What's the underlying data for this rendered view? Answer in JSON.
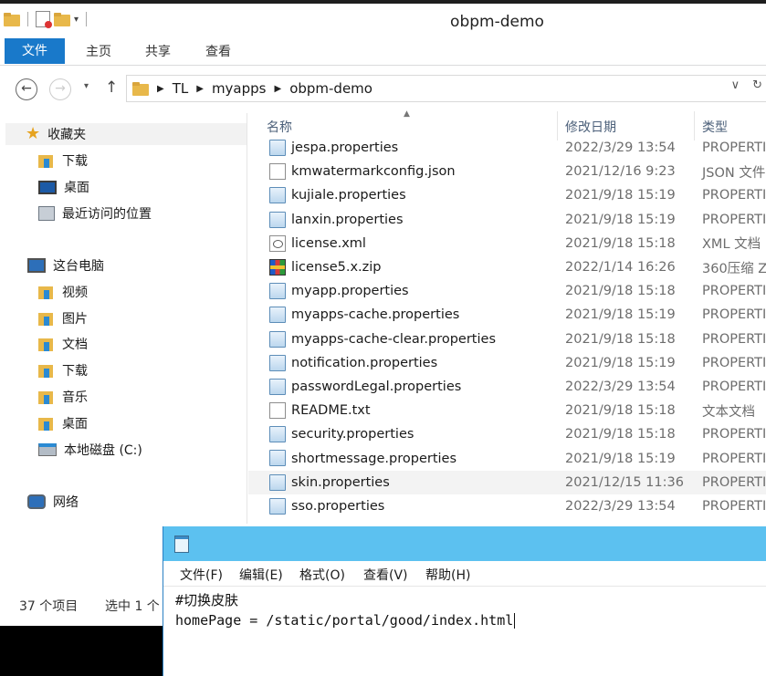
{
  "window": {
    "title": "obpm-demo"
  },
  "ribbon": {
    "tabs": [
      "文件",
      "主页",
      "共享",
      "查看"
    ]
  },
  "address": {
    "crumbs": [
      "TL",
      "myapps",
      "obpm-demo"
    ]
  },
  "nav": {
    "favorites_label": "收藏夹",
    "favorites": [
      "下载",
      "桌面",
      "最近访问的位置"
    ],
    "pc_label": "这台电脑",
    "pc_items": [
      "视频",
      "图片",
      "文档",
      "下载",
      "音乐",
      "桌面",
      "本地磁盘 (C:)"
    ],
    "network_label": "网络"
  },
  "columns": {
    "name": "名称",
    "date": "修改日期",
    "type": "类型"
  },
  "files": [
    {
      "name": "jespa.properties",
      "date": "2022/3/29 13:54",
      "type": "PROPERTI",
      "icon": "properties-file-icon"
    },
    {
      "name": "kmwatermarkconfig.json",
      "date": "2021/12/16 9:23",
      "type": "JSON 文件",
      "icon": "text-file-icon"
    },
    {
      "name": "kujiale.properties",
      "date": "2021/9/18 15:19",
      "type": "PROPERTI",
      "icon": "properties-file-icon"
    },
    {
      "name": "lanxin.properties",
      "date": "2021/9/18 15:19",
      "type": "PROPERTI",
      "icon": "properties-file-icon"
    },
    {
      "name": "license.xml",
      "date": "2021/9/18 15:18",
      "type": "XML 文档",
      "icon": "xml-file-icon"
    },
    {
      "name": "license5.x.zip",
      "date": "2022/1/14 16:26",
      "type": "360压缩 Z",
      "icon": "zip-file-icon"
    },
    {
      "name": "myapp.properties",
      "date": "2021/9/18 15:18",
      "type": "PROPERTI",
      "icon": "properties-file-icon"
    },
    {
      "name": "myapps-cache.properties",
      "date": "2021/9/18 15:19",
      "type": "PROPERTI",
      "icon": "properties-file-icon"
    },
    {
      "name": "myapps-cache-clear.properties",
      "date": "2021/9/18 15:18",
      "type": "PROPERTI",
      "icon": "properties-file-icon"
    },
    {
      "name": "notification.properties",
      "date": "2021/9/18 15:19",
      "type": "PROPERTI",
      "icon": "properties-file-icon"
    },
    {
      "name": "passwordLegal.properties",
      "date": "2022/3/29 13:54",
      "type": "PROPERTI",
      "icon": "properties-file-icon"
    },
    {
      "name": "README.txt",
      "date": "2021/9/18 15:18",
      "type": "文本文档",
      "icon": "text-file-icon"
    },
    {
      "name": "security.properties",
      "date": "2021/9/18 15:18",
      "type": "PROPERTI",
      "icon": "properties-file-icon"
    },
    {
      "name": "shortmessage.properties",
      "date": "2021/9/18 15:19",
      "type": "PROPERTI",
      "icon": "properties-file-icon"
    },
    {
      "name": "skin.properties",
      "date": "2021/12/15 11:36",
      "type": "PROPERTI",
      "icon": "properties-file-icon",
      "hovered": true
    },
    {
      "name": "sso.properties",
      "date": "2022/3/29 13:54",
      "type": "PROPERTI",
      "icon": "properties-file-icon"
    }
  ],
  "status": {
    "count": "37 个项目",
    "selected": "选中 1 个"
  },
  "notepad": {
    "menu": [
      "文件(F)",
      "编辑(E)",
      "格式(O)",
      "查看(V)",
      "帮助(H)"
    ],
    "lines": [
      "#切换皮肤",
      "homePage = /static/portal/good/index.html"
    ]
  },
  "colors": {
    "accent": "#1979ca",
    "notepad_title": "#5cc1f0",
    "hover_row": "#f3f3f3"
  }
}
